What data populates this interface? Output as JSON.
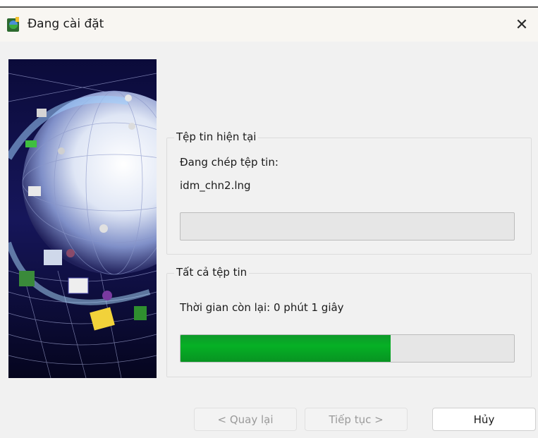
{
  "window": {
    "title": "Đang cài đặt",
    "close_symbol": "✕",
    "icon": "installer-icon"
  },
  "current_file": {
    "legend": "Tệp tin hiện tại",
    "status_label": "Đang chép tệp tin:",
    "file_name": "idm_chn2.lng",
    "progress_fraction": 0.0
  },
  "all_files": {
    "legend": "Tất cả tệp tin",
    "time_remaining": "Thời gian còn lại: 0 phút 1 giây",
    "progress_fraction": 0.63
  },
  "buttons": {
    "back": "< Quay lại",
    "next": "Tiếp tục >",
    "cancel": "Hủy"
  },
  "colors": {
    "progress_green": "#06b025",
    "dialog_bg": "#f1f1f1"
  }
}
